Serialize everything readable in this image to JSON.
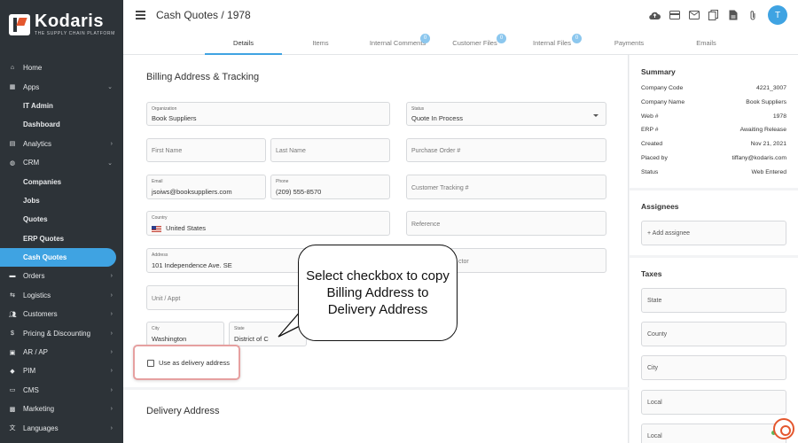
{
  "brand": {
    "name": "Kodaris",
    "tagline": "THE SUPPLY CHAIN PLATFORM"
  },
  "sidebar": {
    "items": [
      {
        "label": "Home",
        "icon": "home-icon"
      },
      {
        "label": "Apps",
        "icon": "grid-icon",
        "chevron": "⌄"
      },
      {
        "label": "IT Admin"
      },
      {
        "label": "Dashboard"
      },
      {
        "label": "Analytics",
        "icon": "chart-icon",
        "chevron": "›"
      },
      {
        "label": "CRM",
        "icon": "crm-icon",
        "chevron": "⌄"
      },
      {
        "label": "Companies"
      },
      {
        "label": "Jobs"
      },
      {
        "label": "Quotes"
      },
      {
        "label": "ERP Quotes"
      },
      {
        "label": "Cash Quotes"
      },
      {
        "label": "Orders",
        "icon": "truck-icon",
        "chevron": "›"
      },
      {
        "label": "Logistics",
        "icon": "logistics-icon",
        "chevron": "›"
      },
      {
        "label": "Customers",
        "icon": "users-icon",
        "chevron": "›"
      },
      {
        "label": "Pricing & Discounting",
        "icon": "dollar-icon",
        "chevron": "›"
      },
      {
        "label": "AR / AP",
        "icon": "money-icon",
        "chevron": "›"
      },
      {
        "label": "PIM",
        "icon": "tag-icon",
        "chevron": "›"
      },
      {
        "label": "CMS",
        "icon": "cms-icon",
        "chevron": "›"
      },
      {
        "label": "Marketing",
        "icon": "marketing-icon",
        "chevron": "›"
      },
      {
        "label": "Languages",
        "icon": "language-icon",
        "chevron": "›"
      }
    ]
  },
  "header": {
    "title": "Cash Quotes / 1978",
    "avatar_letter": "T",
    "icons": [
      "cloud-upload-icon",
      "card-icon",
      "mail-icon",
      "copy-icon",
      "pdf-icon",
      "attachment-icon"
    ]
  },
  "tabs": [
    {
      "label": "Details"
    },
    {
      "label": "Items"
    },
    {
      "label": "Internal Comments",
      "count": "0"
    },
    {
      "label": "Customer Files",
      "count": "0"
    },
    {
      "label": "Internal Files",
      "count": "0"
    },
    {
      "label": "Payments"
    },
    {
      "label": "Emails"
    }
  ],
  "billing": {
    "title": "Billing Address & Tracking",
    "organization_label": "Organization",
    "organization": "Book Suppliers",
    "status_label": "Status",
    "status": "Quote In Process",
    "first_name_ph": "First Name",
    "last_name_ph": "Last Name",
    "po_ph": "Purchase Order #",
    "email_label": "Email",
    "email": "jsoiws@booksuppliers.com",
    "phone_label": "Phone",
    "phone": "(209) 555-8570",
    "tracking_ph": "Customer Tracking #",
    "country_label": "Country",
    "country": "United States",
    "reference_ph": "Reference",
    "address_label": "Address",
    "address": "101 Independence Ave. SE",
    "contractor_partial": "ctor",
    "unit_ph": "Unit / Appt",
    "city_label": "City",
    "city": "Washington",
    "state_label": "State",
    "state_partial": "District of C",
    "checkbox_label": "Use as delivery address"
  },
  "delivery": {
    "title": "Delivery Address"
  },
  "callout": {
    "text": "Select checkbox to copy Billing Address to Delivery Address"
  },
  "summary": {
    "title": "Summary",
    "rows": [
      {
        "k": "Company Code",
        "v": "4221_3007"
      },
      {
        "k": "Company Name",
        "v": "Book Suppliers"
      },
      {
        "k": "Web #",
        "v": "1978"
      },
      {
        "k": "ERP #",
        "v": "Awaiting Release"
      },
      {
        "k": "Created",
        "v": "Nov 21, 2021"
      },
      {
        "k": "Placed by",
        "v": "tiffany@kodaris.com"
      },
      {
        "k": "Status",
        "v": "Web Entered"
      }
    ]
  },
  "assignees": {
    "title": "Assignees",
    "add_label": "+ Add assignee"
  },
  "taxes": {
    "title": "Taxes",
    "fields": [
      "State",
      "County",
      "City",
      "Local",
      "Local"
    ]
  }
}
